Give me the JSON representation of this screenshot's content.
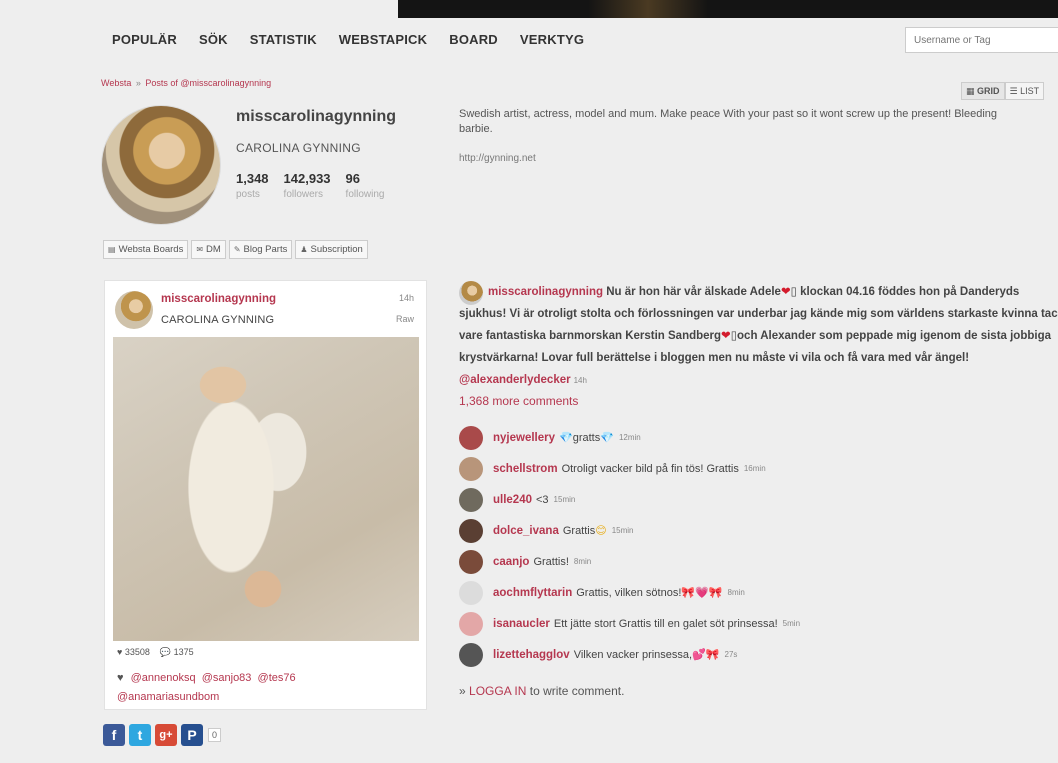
{
  "nav": {
    "items": [
      "POPULÄR",
      "SÖK",
      "STATISTIK",
      "WEBSTAPICK",
      "BOARD",
      "VERKTYG"
    ],
    "search_placeholder": "Username or Tag"
  },
  "breadcrumb": {
    "root": "Websta",
    "separator": "»",
    "current": "Posts of @misscarolinagynning"
  },
  "view_toggle": {
    "grid": "GRID",
    "list": "LIST"
  },
  "profile": {
    "username": "misscarolinagynning",
    "full_name": "CAROLINA GYNNING",
    "posts_count": "1,348",
    "posts_label": "posts",
    "followers_count": "142,933",
    "followers_label": "followers",
    "following_count": "96",
    "following_label": "following",
    "bio": "Swedish artist, actress, model and mum. Make peace With your past so it wont screw up the present! Bleeding barbie.",
    "link": "http://gynning.net",
    "tools": [
      "Websta Boards",
      "DM",
      "Blog Parts",
      "Subscription"
    ]
  },
  "post": {
    "username": "misscarolinagynning",
    "full_name": "CAROLINA GYNNING",
    "time": "14h",
    "visibility": "Raw",
    "likes_count": "33508",
    "comments_count": "1375",
    "likers": [
      "@annenoksq",
      "@sanjo83",
      "@tes76",
      "@anamariasundbom"
    ],
    "caption": {
      "username": "misscarolinagynning",
      "part1": "Nu är hon här vår älskade Adele",
      "part2": "klockan 04.16 föddes hon på Danderyds sjukhus! Vi är otroligt stolta och förlossningen var underbar jag kände mig som världens starkaste kvinna tack vare fantastiska barnmorskan Kerstin Sandberg",
      "part3": "och Alexander som peppade mig igenom de sista jobbiga krystvärkarna! Lovar full berättelse i bloggen men nu måste vi vila och få vara med vår ängel!",
      "mention": "@alexanderlydecker",
      "time": "14h"
    },
    "more_comments": "1,368 more comments",
    "comments": [
      {
        "user": "nyjewellery",
        "text": "gratts",
        "emoji": "💎",
        "emoji_after": "💎",
        "time": "12min",
        "avatar": "#a94a4a"
      },
      {
        "user": "schellstrom",
        "text": "Otroligt vacker bild på fin tös! Grattis",
        "emoji": "",
        "emoji_after": "",
        "time": "16min",
        "avatar": "#b8957a"
      },
      {
        "user": "ulle240",
        "text": "<3",
        "emoji": "",
        "emoji_after": "",
        "time": "15min",
        "avatar": "#6f6a5e"
      },
      {
        "user": "dolce_ivana",
        "text": "Grattis",
        "emoji": "",
        "emoji_after": "😊",
        "time": "15min",
        "avatar": "#5a3f33"
      },
      {
        "user": "caanjo",
        "text": "Grattis!",
        "emoji": "",
        "emoji_after": "",
        "time": "8min",
        "avatar": "#7a4b3a"
      },
      {
        "user": "aochmflyttarin",
        "text": "Grattis, vilken sötnos!",
        "emoji": "",
        "emoji_after": "🎀💗🎀",
        "time": "8min",
        "avatar": "#dcdcdc"
      },
      {
        "user": "isanaucler",
        "text": "Ett jätte stort Grattis till en galet söt prinsessa!",
        "emoji": "",
        "emoji_after": "",
        "time": "5min",
        "avatar": "#e3a7a7"
      },
      {
        "user": "lizettehagglov",
        "text": "Vilken vacker prinsessa,",
        "emoji": "",
        "emoji_after": "💕🎀",
        "time": "27s",
        "avatar": "#555555"
      }
    ],
    "login": {
      "prefix": "»",
      "link": "LOGGA IN",
      "suffix": "to write comment."
    }
  },
  "share": {
    "count": "0",
    "buttons": [
      "f",
      "t",
      "g+",
      "P"
    ]
  },
  "colors": {
    "accent": "#b5374f",
    "background": "#eeeeee",
    "heart": "#d31b2c"
  }
}
